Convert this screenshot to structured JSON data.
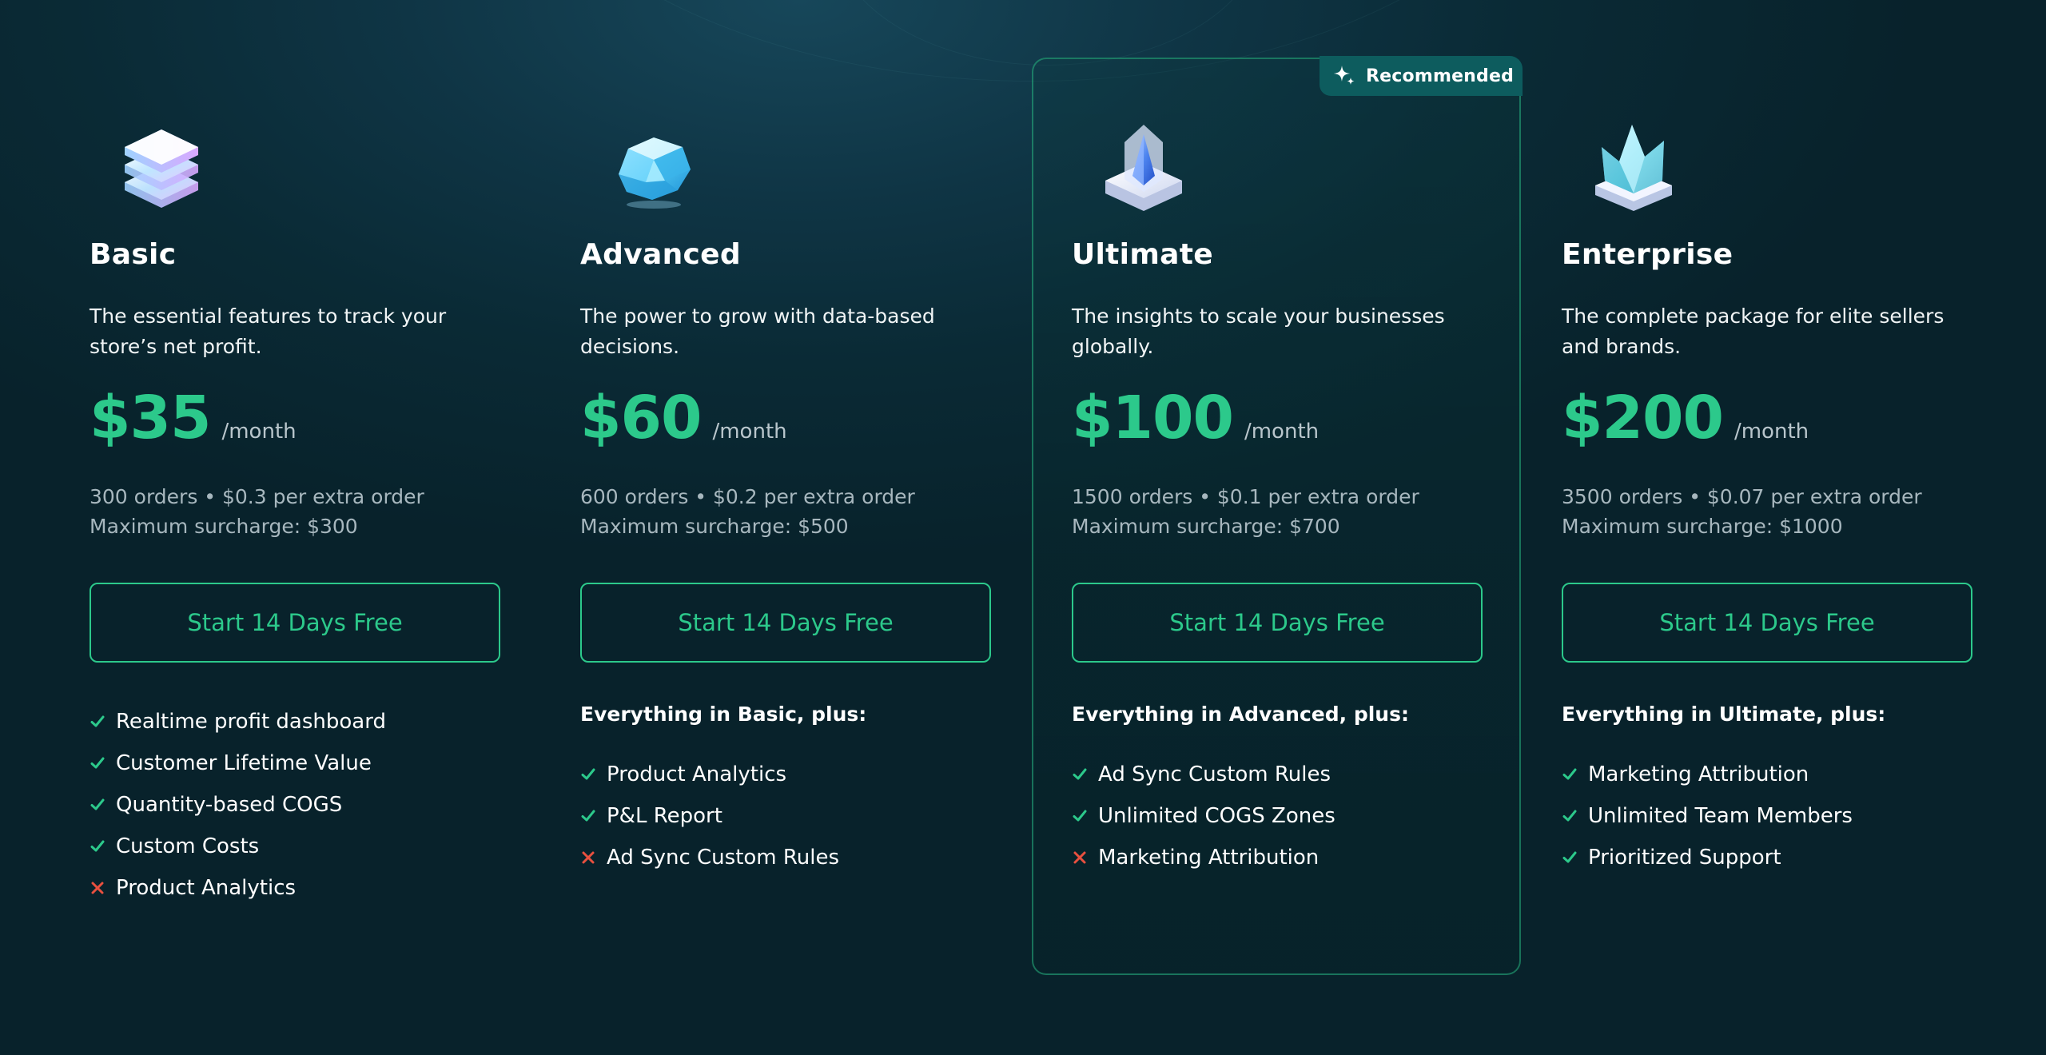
{
  "colors": {
    "accent": "#2cc98b",
    "check": "#2cc98b",
    "cross": "#e8503f",
    "badge_bg": "#0d5c5e",
    "background": "#0a2a35"
  },
  "recommended_badge": {
    "label": "Recommended",
    "icon": "sparkle-icon"
  },
  "plans": [
    {
      "id": "basic",
      "icon": "stacked-layers-icon",
      "name": "Basic",
      "description": "The essential features to track your store’s net profit.",
      "price": "$35",
      "period": "/month",
      "orders_line": "300 orders • $0.3 per extra order",
      "surcharge_line": "Maximum surcharge: $300",
      "cta_label": "Start 14 Days Free",
      "features_heading": "",
      "features": [
        {
          "label": "Realtime profit dashboard",
          "included": true
        },
        {
          "label": "Customer Lifetime Value",
          "included": true
        },
        {
          "label": "Quantity-based COGS",
          "included": true
        },
        {
          "label": "Custom Costs",
          "included": true
        },
        {
          "label": "Product Analytics",
          "included": false
        }
      ]
    },
    {
      "id": "advanced",
      "icon": "gem-icon",
      "name": "Advanced",
      "description": "The power to grow with data-based decisions.",
      "price": "$60",
      "period": "/month",
      "orders_line": "600 orders • $0.2 per extra order",
      "surcharge_line": "Maximum surcharge: $500",
      "cta_label": "Start 14 Days Free",
      "features_heading": "Everything in Basic, plus:",
      "features": [
        {
          "label": "Product Analytics",
          "included": true
        },
        {
          "label": "P&L Report",
          "included": true
        },
        {
          "label": "Ad Sync Custom Rules",
          "included": false
        }
      ]
    },
    {
      "id": "ultimate",
      "icon": "crystal-pedestal-icon",
      "name": "Ultimate",
      "description": "The insights to scale your businesses globally.",
      "price": "$100",
      "period": "/month",
      "orders_line": "1500 orders • $0.1 per extra order",
      "surcharge_line": "Maximum surcharge: $700",
      "cta_label": "Start 14 Days Free",
      "features_heading": "Everything in Advanced, plus:",
      "features": [
        {
          "label": "Ad Sync Custom Rules",
          "included": true
        },
        {
          "label": "Unlimited COGS Zones",
          "included": true
        },
        {
          "label": "Marketing Attribution",
          "included": false
        }
      ]
    },
    {
      "id": "enterprise",
      "icon": "crystal-crown-icon",
      "name": "Enterprise",
      "description": "The complete package for elite sellers and brands.",
      "price": "$200",
      "period": "/month",
      "orders_line": "3500 orders • $0.07 per extra order",
      "surcharge_line": "Maximum surcharge: $1000",
      "cta_label": "Start 14 Days Free",
      "features_heading": "Everything in Ultimate, plus:",
      "features": [
        {
          "label": "Marketing Attribution",
          "included": true
        },
        {
          "label": "Unlimited Team Members",
          "included": true
        },
        {
          "label": "Prioritized Support",
          "included": true
        }
      ]
    }
  ]
}
